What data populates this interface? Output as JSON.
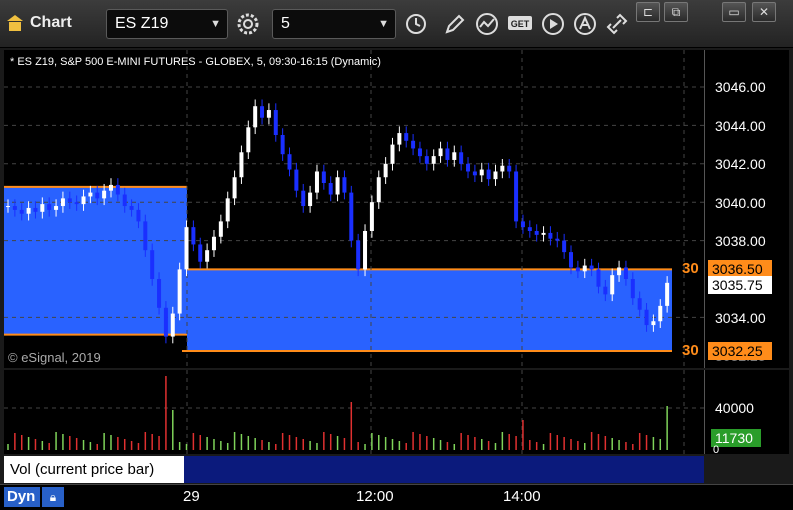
{
  "window": {
    "title": "Chart",
    "symbol": "ES Z19",
    "interval": "5"
  },
  "chart": {
    "info_line": "* ES Z19, S&P 500 E-MINI FUTURES - GLOBEX, 5, 09:30-16:15 (Dynamic)",
    "copyright": "© eSignal, 2019",
    "price_ticks": [
      "3046.00",
      "3044.00",
      "3042.00",
      "3040.00",
      "3038.00",
      "3034.00"
    ],
    "price_tag_upper": "3036.50",
    "price_tag_current": "3035.75",
    "price_tag_lower": "3032.25",
    "partial_tick": "3032.25",
    "level_upper_label": "30",
    "level_lower_label": "30",
    "volume_tick": "40000",
    "volume_tag": "11730",
    "volume_zero": "0",
    "volume_panel_label": "Vol (current price bar)",
    "time_labels": [
      "29",
      "12:00",
      "14:00"
    ],
    "dyn_label": "Dyn",
    "colors": {
      "zone": "#2962ff",
      "level_line": "#ff8c1a",
      "candle_up": "#ffffff",
      "candle_down": "#1a2fff",
      "vol_up": "#7fd35a",
      "vol_down": "#e03030",
      "tag_current_bg": "#ffffff",
      "tag_level_bg": "#ff8c1a"
    }
  }
}
